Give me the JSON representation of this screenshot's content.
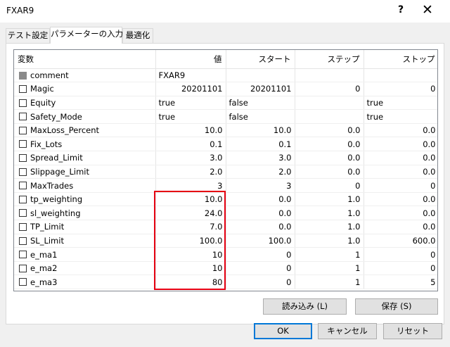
{
  "window": {
    "title": "FXAR9",
    "help_label": "?",
    "close_label": "✕"
  },
  "tabs": [
    {
      "label": "テスト設定"
    },
    {
      "label": "パラメーターの入力"
    },
    {
      "label": "最適化"
    }
  ],
  "grid": {
    "columns": [
      "変数",
      "値",
      "スタート",
      "ステップ",
      "ストップ"
    ],
    "rows": [
      {
        "name": "comment",
        "value": "FXAR9",
        "start": "",
        "step": "",
        "stop": "",
        "checkbox": "gray"
      },
      {
        "name": "Magic",
        "value": "20201101",
        "start": "20201101",
        "step": "0",
        "stop": "0"
      },
      {
        "name": "Equity",
        "value": "true",
        "start": "false",
        "step": "",
        "stop": "true"
      },
      {
        "name": "Safety_Mode",
        "value": "true",
        "start": "false",
        "step": "",
        "stop": "true"
      },
      {
        "name": "MaxLoss_Percent",
        "value": "10.0",
        "start": "10.0",
        "step": "0.0",
        "stop": "0.0"
      },
      {
        "name": "Fix_Lots",
        "value": "0.1",
        "start": "0.1",
        "step": "0.0",
        "stop": "0.0"
      },
      {
        "name": "Spread_Limit",
        "value": "3.0",
        "start": "3.0",
        "step": "0.0",
        "stop": "0.0"
      },
      {
        "name": "Slippage_Limit",
        "value": "2.0",
        "start": "2.0",
        "step": "0.0",
        "stop": "0.0"
      },
      {
        "name": "MaxTrades",
        "value": "3",
        "start": "3",
        "step": "0",
        "stop": "0"
      },
      {
        "name": "tp_weighting",
        "value": "10.0",
        "start": "0.0",
        "step": "1.0",
        "stop": "0.0"
      },
      {
        "name": "sl_weighting",
        "value": "24.0",
        "start": "0.0",
        "step": "1.0",
        "stop": "0.0"
      },
      {
        "name": "TP_Limit",
        "value": "7.0",
        "start": "0.0",
        "step": "1.0",
        "stop": "0.0"
      },
      {
        "name": "SL_Limit",
        "value": "100.0",
        "start": "100.0",
        "step": "1.0",
        "stop": "600.0"
      },
      {
        "name": "e_ma1",
        "value": "10",
        "start": "0",
        "step": "1",
        "stop": "0"
      },
      {
        "name": "e_ma2",
        "value": "10",
        "start": "0",
        "step": "1",
        "stop": "0"
      },
      {
        "name": "e_ma3",
        "value": "80",
        "start": "0",
        "step": "1",
        "stop": "5"
      }
    ]
  },
  "buttons": {
    "load": "読み込み (L)",
    "save": "保存 (S)",
    "ok": "OK",
    "cancel": "キャンセル",
    "reset": "リセット"
  },
  "colors": {
    "highlight": "#e60012",
    "accent": "#0078d7"
  }
}
